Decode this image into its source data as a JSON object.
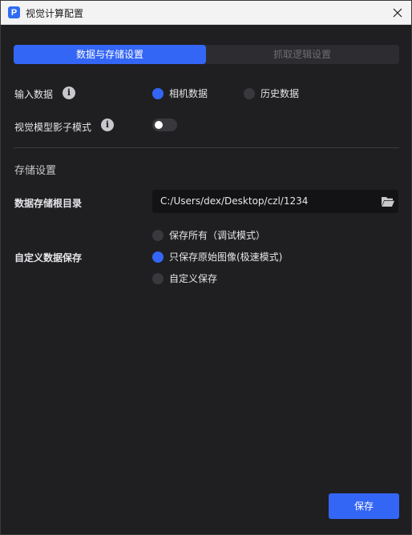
{
  "window": {
    "title": "视觉计算配置",
    "app_icon_letter": "P"
  },
  "tabs": [
    {
      "label": "数据与存储设置",
      "active": true
    },
    {
      "label": "抓取逻辑设置",
      "active": false
    }
  ],
  "input_data": {
    "label": "输入数据",
    "options": [
      {
        "label": "相机数据",
        "checked": true
      },
      {
        "label": "历史数据",
        "checked": false
      }
    ]
  },
  "shadow_mode": {
    "label": "视觉模型影子模式",
    "enabled": false
  },
  "storage": {
    "section_title": "存储设置",
    "root_dir_label": "数据存储根目录",
    "root_dir_value": "C:/Users/dex/Desktop/czl/1234",
    "custom_save_label": "自定义数据保存",
    "save_options": [
      {
        "label": "保存所有（调试模式）",
        "checked": false
      },
      {
        "label": "只保存原始图像(极速模式)",
        "checked": true
      },
      {
        "label": "自定义保存",
        "checked": false
      }
    ]
  },
  "footer": {
    "save_label": "保存"
  },
  "colors": {
    "accent": "#3466f5",
    "background": "#1f1f21",
    "titlebar": "#f3f3f3"
  }
}
